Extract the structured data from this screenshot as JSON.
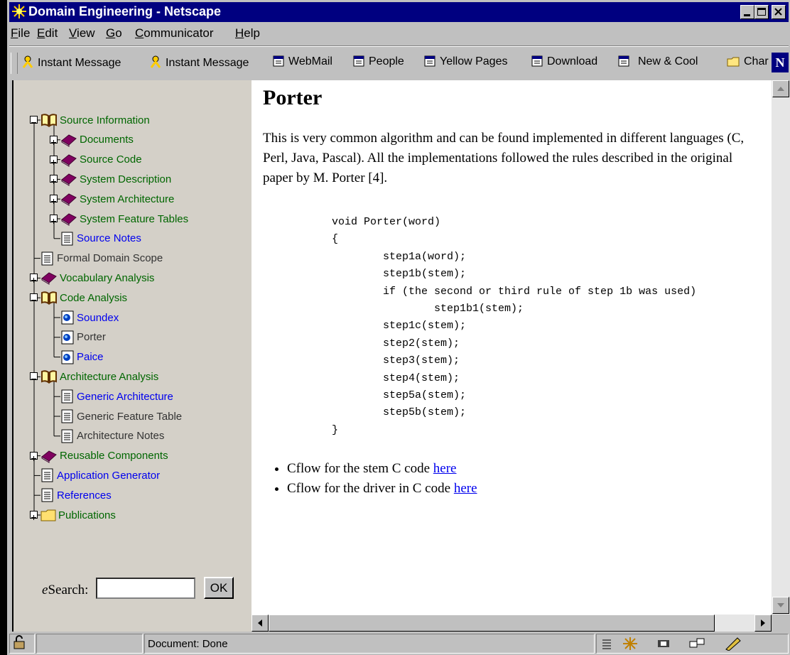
{
  "window": {
    "title": "Domain Engineering - Netscape",
    "colors": {
      "titlebar": "#000080",
      "link": "#0000ee",
      "tree_text": "#006600"
    }
  },
  "menubar": {
    "items": [
      {
        "pre": "",
        "u": "F",
        "post": "ile"
      },
      {
        "pre": "",
        "u": "E",
        "post": "dit"
      },
      {
        "pre": "",
        "u": "V",
        "post": "iew"
      },
      {
        "pre": "",
        "u": "G",
        "post": "o"
      },
      {
        "pre": "",
        "u": "C",
        "post": "ommunicator"
      },
      {
        "pre": "",
        "u": "H",
        "post": "elp"
      }
    ]
  },
  "toolbar": {
    "items": [
      {
        "label": "Instant Message",
        "icon": "person-icon"
      },
      {
        "label": "Instant Message",
        "icon": "person-icon"
      },
      {
        "label": "WebMail",
        "icon": "bookmark-page-icon"
      },
      {
        "label": "People",
        "icon": "bookmark-page-icon"
      },
      {
        "label": "Yellow Pages",
        "icon": "bookmark-page-icon"
      },
      {
        "label": "Download",
        "icon": "bookmark-page-icon"
      },
      {
        "label": "New & Cool",
        "icon": "bookmark-page-icon"
      },
      {
        "label": "Char",
        "icon": "folder-icon"
      }
    ]
  },
  "sidebar": {
    "tree": [
      {
        "label": "Source Information",
        "icon": "open-book-icon",
        "color": "green"
      },
      {
        "label": "Documents",
        "icon": "closed-book-icon",
        "color": "green"
      },
      {
        "label": "Source Code",
        "icon": "closed-book-icon",
        "color": "green"
      },
      {
        "label": "System Description",
        "icon": "closed-book-icon",
        "color": "green"
      },
      {
        "label": "System Architecture",
        "icon": "closed-book-icon",
        "color": "green"
      },
      {
        "label": "System Feature Tables",
        "icon": "closed-book-icon",
        "color": "green"
      },
      {
        "label": "Source Notes",
        "icon": "page-icon",
        "color": "blue"
      },
      {
        "label": "Formal Domain Scope",
        "icon": "page-icon",
        "color": "dark"
      },
      {
        "label": "Vocabulary Analysis",
        "icon": "closed-book-icon",
        "color": "green"
      },
      {
        "label": "Code Analysis",
        "icon": "open-book-icon",
        "color": "green"
      },
      {
        "label": "Soundex",
        "icon": "globe-page-icon",
        "color": "blue"
      },
      {
        "label": "Porter",
        "icon": "globe-page-icon",
        "color": "dark"
      },
      {
        "label": "Paice",
        "icon": "globe-page-icon",
        "color": "blue"
      },
      {
        "label": "Architecture Analysis",
        "icon": "open-book-icon",
        "color": "green"
      },
      {
        "label": "Generic Architecture",
        "icon": "page-icon",
        "color": "blue"
      },
      {
        "label": "Generic Feature Table",
        "icon": "page-icon",
        "color": "dark"
      },
      {
        "label": "Architecture Notes",
        "icon": "page-icon",
        "color": "dark"
      },
      {
        "label": "Reusable Components",
        "icon": "closed-book-icon",
        "color": "green"
      },
      {
        "label": "Application Generator",
        "icon": "page-icon",
        "color": "blue"
      },
      {
        "label": "References",
        "icon": "page-icon",
        "color": "blue"
      },
      {
        "label": "Publications",
        "icon": "folder-icon",
        "color": "green"
      }
    ],
    "search": {
      "label_prefix": "e",
      "label_rest": "Search:",
      "value": "",
      "button": "OK"
    }
  },
  "content": {
    "title": "Porter",
    "paragraph": "This is very common algorithm and can be found implemented in different languages (C, Perl, Java, Pascal). All the implementations followed the rules described in the original paper by M. Porter [4].",
    "code": "void Porter(word)\n{\n        step1a(word);\n        step1b(stem);\n        if (the second or third rule of step 1b was used)\n                step1b1(stem);\n        step1c(stem);\n        step2(stem);\n        step3(stem);\n        step4(stem);\n        step5a(stem);\n        step5b(stem);\n}",
    "bullets": [
      {
        "text": "Cflow for the stem C code ",
        "link": "here"
      },
      {
        "text": "Cflow for the driver in C code ",
        "link": "here"
      }
    ]
  },
  "statusbar": {
    "text": "Document: Done"
  }
}
